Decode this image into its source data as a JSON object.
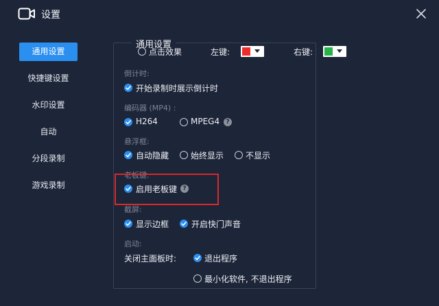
{
  "window": {
    "title": "设置"
  },
  "sidebar": {
    "items": [
      {
        "label": "通用设置",
        "active": true
      },
      {
        "label": "快捷键设置",
        "active": false
      },
      {
        "label": "水印设置",
        "active": false
      },
      {
        "label": "自动",
        "active": false
      },
      {
        "label": "分段录制",
        "active": false
      },
      {
        "label": "游戏录制",
        "active": false
      }
    ]
  },
  "general": {
    "section_title": "通用设置",
    "click_effect": {
      "label": "点击效果",
      "left_key_label": "左键:",
      "right_key_label": "右键:",
      "left_color": "#ef2b2b",
      "right_color": "#28b34a"
    },
    "countdown": {
      "heading": "倒计时:",
      "option": "开始录制时展示倒计时"
    },
    "encoder": {
      "heading": "编码器 (MP4) :",
      "opt_h264": "H264",
      "opt_mpeg4": "MPEG4"
    },
    "float_window": {
      "heading": "悬浮框:",
      "opt_auto_hide": "自动隐藏",
      "opt_always_show": "始终显示",
      "opt_hide": "不显示"
    },
    "boss_key": {
      "heading": "老板键:",
      "option": "启用老板键"
    },
    "screenshot": {
      "heading": "截屏:",
      "opt_border": "显示边框",
      "opt_shutter": "开启快门声音"
    },
    "startup": {
      "heading": "启动:",
      "close_label": "关闭主面板时:",
      "opt_exit": "退出程序",
      "opt_minimize": "最小化软件, 不退出程序"
    }
  },
  "help_glyph": "?",
  "accent_color": "#2b8ff0",
  "highlight_color": "#d92a2a"
}
